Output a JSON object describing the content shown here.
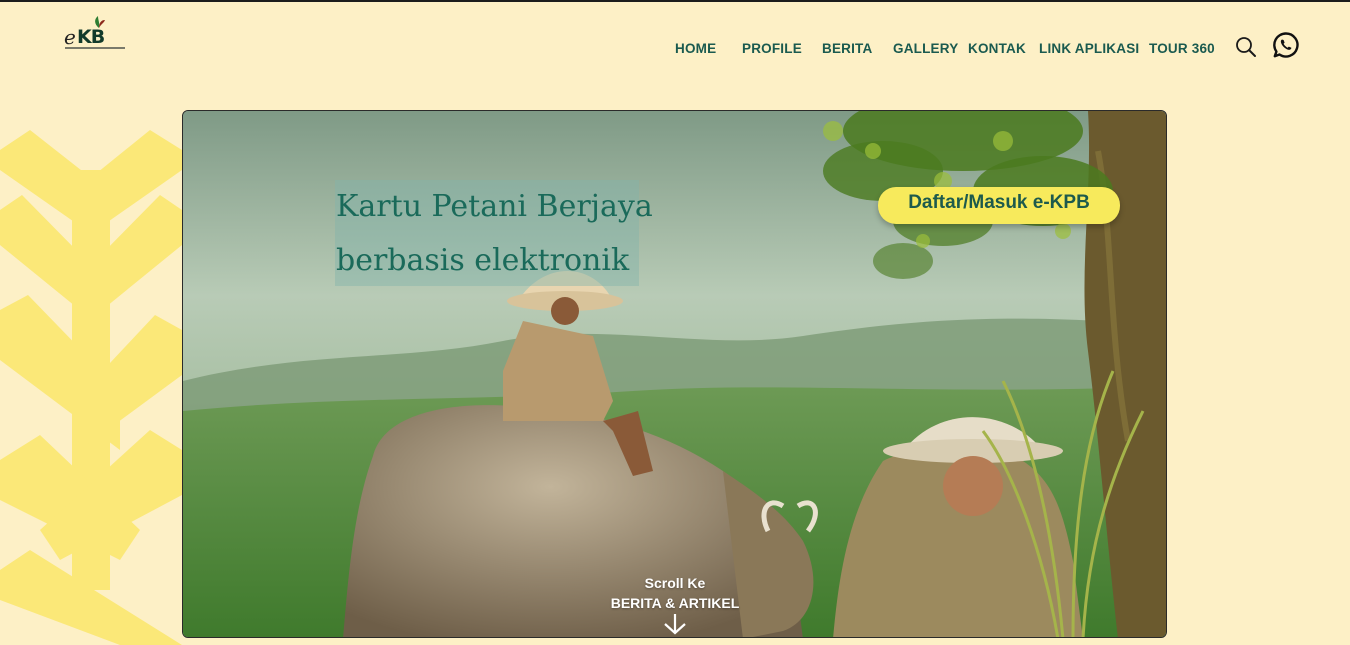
{
  "logo": {
    "letter_e": "e",
    "letters_kb": "KB",
    "icon": "leaf-icon"
  },
  "nav": {
    "items": [
      {
        "label": "HOME"
      },
      {
        "label": "PROFILE"
      },
      {
        "label": "BERITA"
      },
      {
        "label": "GALLERY"
      },
      {
        "label": "KONTAK"
      },
      {
        "label": "LINK APLIKASI"
      },
      {
        "label": "TOUR 360"
      }
    ],
    "search_icon": "search-icon",
    "whatsapp_icon": "whatsapp-icon"
  },
  "hero": {
    "title_line1": "Kartu Petani Berjaya",
    "title_line2": "berbasis elektronik",
    "cta_label": "Daftar/Masuk e-KPB",
    "scroll_line1": "Scroll Ke",
    "scroll_line2": "BERITA & ARTIKEL",
    "scroll_icon": "arrow-down-icon"
  },
  "colors": {
    "background": "#fdf0c6",
    "nav_text": "#1a5a4f",
    "accent_yellow": "#f7ea5c",
    "deco_yellow": "#fbe878"
  }
}
